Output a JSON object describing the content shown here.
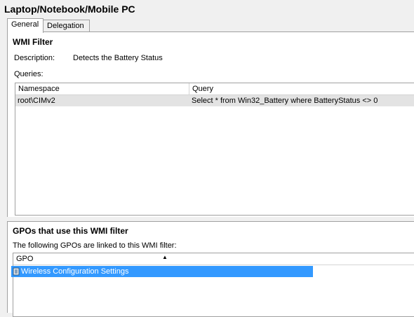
{
  "window": {
    "title": "Laptop/Notebook/Mobile PC"
  },
  "tabs": [
    {
      "label": "General"
    },
    {
      "label": "Delegation"
    }
  ],
  "wmi_filter": {
    "heading": "WMI Filter",
    "description_label": "Description:",
    "description_value": "Detects the Battery Status",
    "queries_label": "Queries:",
    "columns": [
      "Namespace",
      "Query"
    ],
    "rows": [
      {
        "namespace": "root\\CIMv2",
        "query": "Select * from Win32_Battery where BatteryStatus <> 0"
      }
    ]
  },
  "gpos": {
    "heading": "GPOs that use this WMI filter",
    "subtitle": "The following GPOs are linked to this WMI filter:",
    "column": "GPO",
    "items": [
      {
        "name": "Wireless Configuration Settings",
        "icon": "gpo-scroll-icon"
      }
    ],
    "accent_color": "#3399ff"
  }
}
